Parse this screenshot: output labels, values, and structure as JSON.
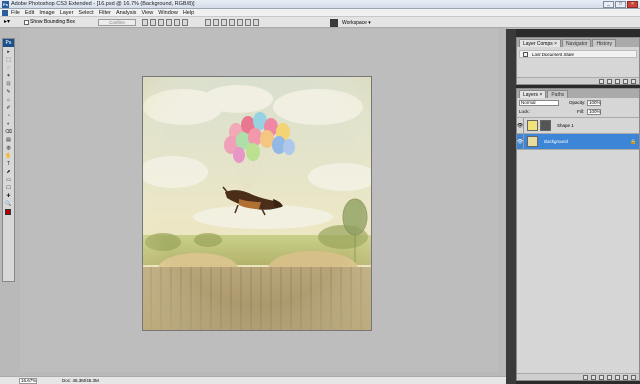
{
  "window": {
    "title": "Adobe Photoshop CS3 Extended - [16.psd @ 16.7% (Background, RGB/8)]",
    "app_icon": "Ps",
    "minimize": "_",
    "maximize": "□",
    "close": "×"
  },
  "menu": [
    "File",
    "Edit",
    "Image",
    "Layer",
    "Select",
    "Filter",
    "Analysis",
    "View",
    "Window",
    "Help"
  ],
  "options": {
    "tool_preset": "▸▾",
    "show_bounding_box": "Show Bounding Box",
    "confirm": "Confirm",
    "workspace": "Workspace ▾"
  },
  "tools": [
    "▸",
    "⬚",
    "◌",
    "✶",
    "⊡",
    "✎",
    "⌂",
    "✐",
    "◔",
    "◐",
    "⌫",
    "▤",
    "◍",
    "✋",
    "T",
    "⬈",
    "▭",
    "☐",
    "✚",
    "🔍"
  ],
  "toolbox_logo": "Ps",
  "status": {
    "zoom": "16.67%",
    "doc": "Doc: 45.3M/45.3M"
  },
  "layer_comps_panel": {
    "tabs": [
      "Layer Comps ×",
      "Navigator",
      "History"
    ],
    "row": "Last Document State"
  },
  "layers_panel": {
    "tabs": [
      "Layers ×",
      "Paths"
    ],
    "blend_mode": "Normal",
    "opacity_label": "Opacity:",
    "opacity": "100%",
    "lock_label": "Lock:",
    "fill_label": "Fill:",
    "fill": "100%",
    "layers": [
      {
        "name": "Shape 1",
        "selected": false
      },
      {
        "name": "Background",
        "selected": true
      }
    ]
  },
  "colors": {
    "foreground": "#b30000",
    "selection": "#3d85d6"
  }
}
